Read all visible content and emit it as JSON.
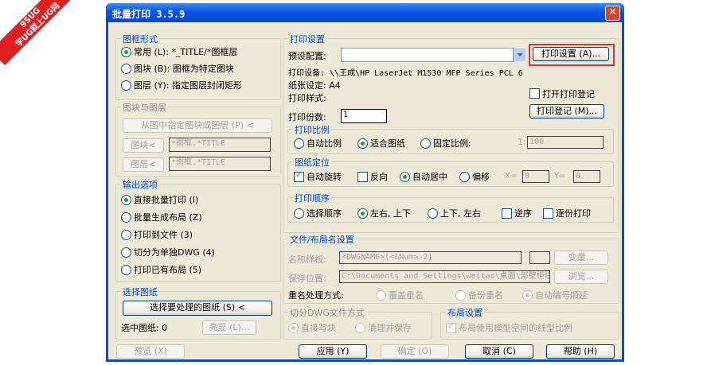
{
  "watermark": {
    "line1": "9SUG",
    "line2": "学UG就上UG网"
  },
  "window": {
    "title": "批量打印 3.5.9",
    "close_glyph": "✕"
  },
  "frame_style": {
    "label": "图框形式",
    "options": [
      "常用 (L): *_TITLE/*图框层",
      "图块 (B): 图框为特定图块",
      "图层 (Y): 指定图层封闭矩形"
    ],
    "selected": 0
  },
  "block_layer": {
    "label": "图块与图层",
    "pick_button": "从图中指定图块或图层 (P) <",
    "block_button": "图块<",
    "block_value": "*图框,*TITLE",
    "layer_button": "图层<",
    "layer_value": "*图框,*TITLE"
  },
  "output_options": {
    "label": "输出选项",
    "options": [
      "直接批量打印 (I)",
      "批量生成布局 (Z)",
      "打印到文件 (3)",
      "切分为单独DWG (4)",
      "打印已有布局 (5)"
    ],
    "selected": 0
  },
  "select_drawings": {
    "label": "选择图纸",
    "select_button": "选择要处理的图纸 (S) <",
    "selected_text": "选中图纸: 0",
    "highlight_button": "亮显 (L)..."
  },
  "print_settings": {
    "label": "打印设置",
    "preset_label": "预设配置:",
    "preset_value": "",
    "settings_button": "打印设置 (A)...",
    "device_text": "打印设备: \\\\王成\\HP LaserJet M1530 MFP Series PCL 6",
    "paper_text": "纸张设定: A4",
    "style_text": "打印样式:",
    "open_log_label": "打开打印登记",
    "log_button": "打印登记 (M)...",
    "copies_label": "打印份数:",
    "copies_value": "1"
  },
  "print_scale": {
    "label": "打印比例",
    "options": [
      "自动比例",
      "适合图纸",
      "固定比例:"
    ],
    "selected": 1,
    "ratio_prefix": "1:",
    "ratio_value": "100"
  },
  "paper_position": {
    "label": "图纸定位",
    "auto_rotate": "自动旋转",
    "reverse": "反向",
    "center": "自动居中",
    "offset": "偏移",
    "x_label": "X=",
    "x_value": "0",
    "y_label": "Y=",
    "y_value": "0"
  },
  "print_order": {
    "label": "打印顺序",
    "options": [
      "选择顺序",
      "左右, 上下",
      "上下, 左右"
    ],
    "selected": 1,
    "reverse_label": "逆序",
    "collate_label": "逐份打印"
  },
  "file_layout": {
    "label": "文件/布局名设置",
    "name_label": "名称样板:",
    "name_value": "<DWGNAME>(<&Num>-2)",
    "variable_button": "变量...",
    "save_label": "保存位置:",
    "save_value": "C:\\Documents and Settings\\weitao\\桌面\\部壁柜综合",
    "browse_button": "浏览...",
    "dup_label": "重名处理方式:",
    "dup_options": [
      "覆盖重名",
      "备份重名",
      "自动编号顺延"
    ],
    "dup_selected": 2
  },
  "split_dwg": {
    "label": "切分DWG文件方式",
    "options": [
      "直接写块",
      "清理并保存"
    ],
    "selected": 0
  },
  "layout_settings": {
    "label": "布局设置",
    "linetype_label": "布局使用模型空间的线型比例"
  },
  "bottom": {
    "preview": "预览 (X)",
    "apply": "应用 (Y)",
    "ok": "确定 (O)",
    "cancel": "取消 (C)",
    "help": "帮助 (H)"
  }
}
